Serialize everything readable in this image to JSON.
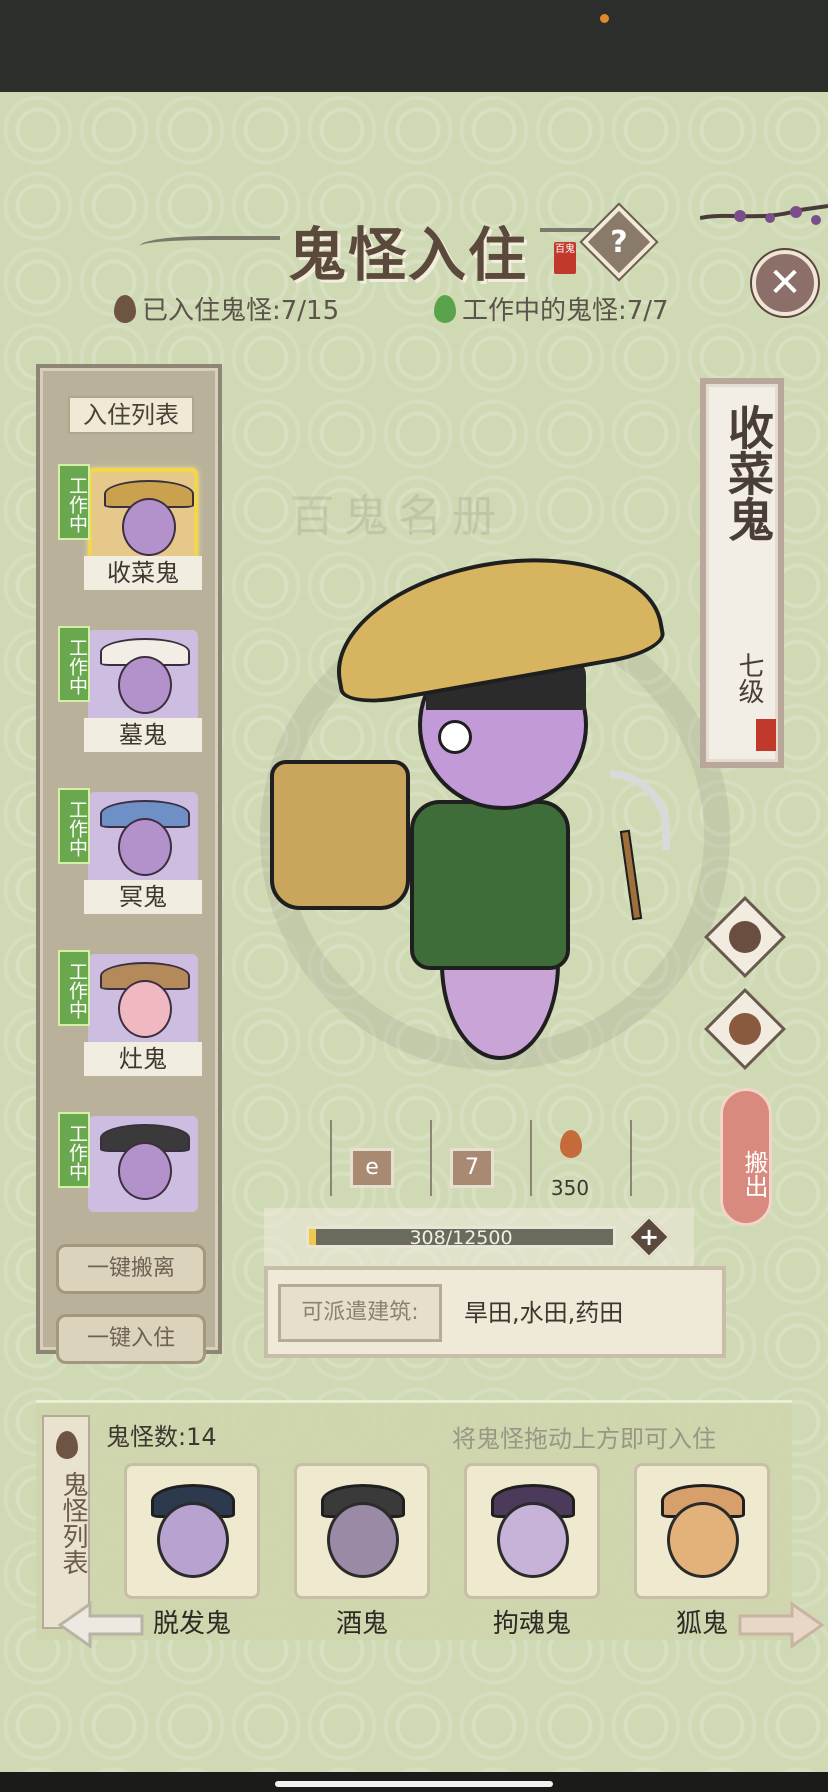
{
  "header": {
    "title": "鬼怪入住",
    "seal": "百鬼",
    "help_symbol": "?",
    "close_symbol": "✕",
    "resident_count": "已入住鬼怪:7/15",
    "working_count": "工作中的鬼怪:7/7"
  },
  "left_panel": {
    "title": "入住列表",
    "status_tag": "工作中",
    "residents": [
      {
        "name": "收菜鬼",
        "status": "工作中",
        "selected": true
      },
      {
        "name": "墓鬼",
        "status": "工作中"
      },
      {
        "name": "冥鬼",
        "status": "工作中"
      },
      {
        "name": "灶鬼",
        "status": "工作中"
      },
      {
        "name": "",
        "status": "工作中"
      }
    ],
    "btn_remove_all": "一键搬离",
    "btn_move_in_all": "一键入住"
  },
  "ghost": {
    "name": "收菜鬼",
    "level": "七级",
    "seal": "百鬼",
    "background_text": "百鬼名册",
    "slot2_value": "7",
    "slot3_value": "350",
    "xp_text": "308/12500",
    "xp_fraction": 0.0246,
    "xp_plus": "+",
    "dispatch_label": "可派遣建筑:",
    "dispatch_value": "旱田,水田,药田",
    "move_out": "搬出"
  },
  "bottom": {
    "side_label": "鬼怪列表",
    "count": "鬼怪数:14",
    "hint": "将鬼怪拖动上方即可入住",
    "ghosts": [
      {
        "name": "脱发鬼"
      },
      {
        "name": "酒鬼"
      },
      {
        "name": "拘魂鬼"
      },
      {
        "name": "狐鬼"
      }
    ]
  },
  "colors": {
    "background": "#cfd9b4",
    "working_tag": "#6aa84f",
    "xp_fill": "#f1c94a",
    "move_out": "#d88a7e"
  },
  "icons": {
    "help": "question-diamond-icon",
    "close": "close-icon",
    "flame": "ghost-flame-icon",
    "plus": "plus-icon",
    "arrow_left": "arrow-left-icon",
    "arrow_right": "arrow-right-icon"
  }
}
